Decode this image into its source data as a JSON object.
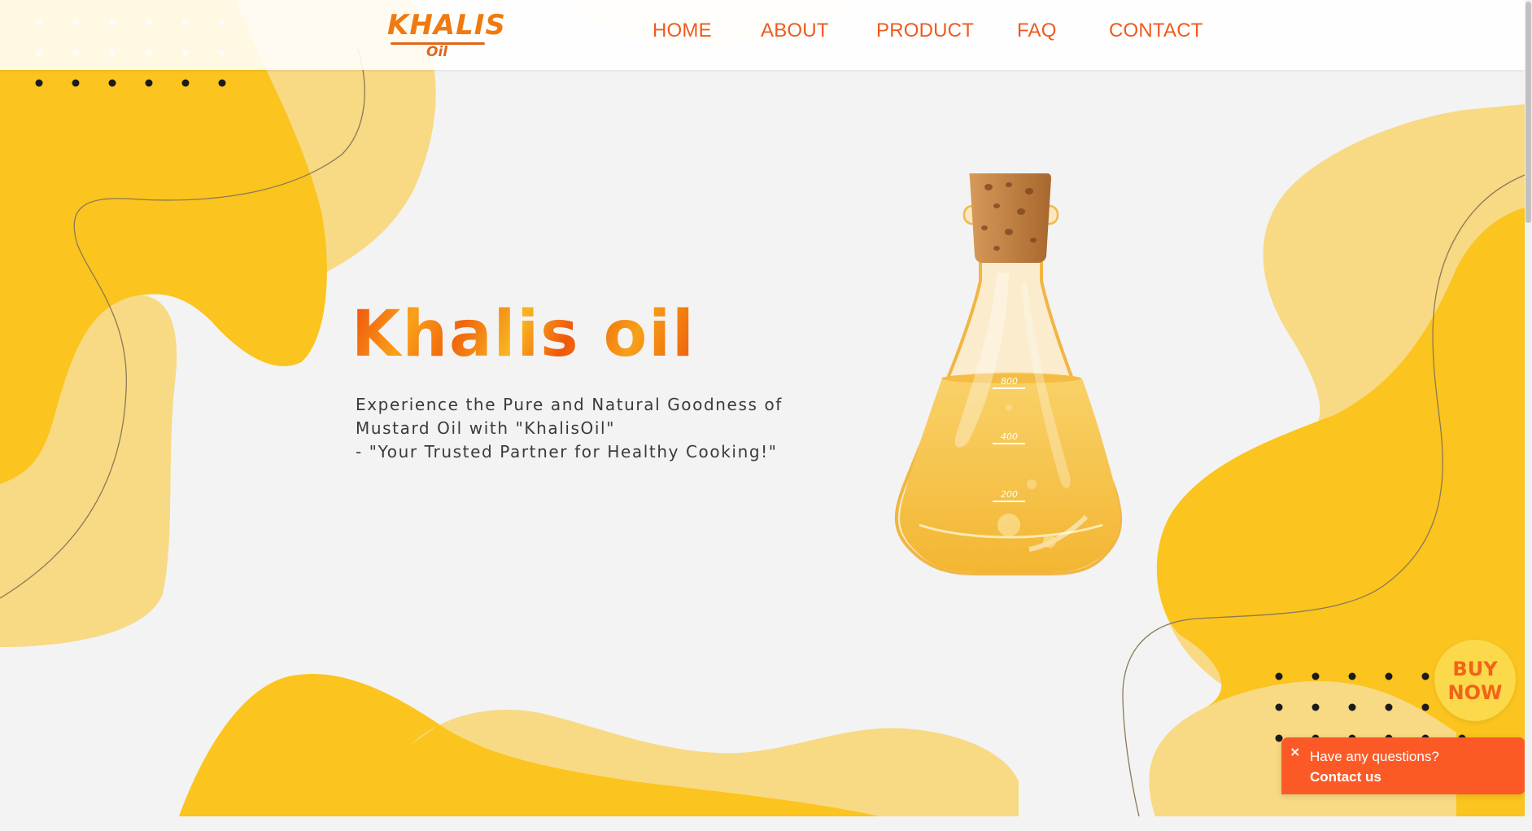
{
  "brand": {
    "logo_text": "KHALIS",
    "logo_subtext": "Oil"
  },
  "nav": {
    "items": [
      {
        "label": "HOME"
      },
      {
        "label": "ABOUT"
      },
      {
        "label": "PRODUCT"
      },
      {
        "label": "FAQ"
      },
      {
        "label": "CONTACT"
      }
    ]
  },
  "hero": {
    "title": "Khalis oil",
    "description_lines": [
      "Experience the Pure and Natural Goodness of",
      "Mustard Oil with \"KhalisOil\"",
      "- \"Your Trusted Partner for Healthy Cooking!\""
    ]
  },
  "flask": {
    "markings": [
      "800",
      "400",
      "200"
    ]
  },
  "buy_now": {
    "line1": "BUY",
    "line2": "NOW"
  },
  "contact_popup": {
    "close_symbol": "×",
    "question": "Have any questions?",
    "cta": "Contact us"
  },
  "colors": {
    "accent": "#ee5a1e",
    "yellow": "#fbc41e",
    "light_yellow": "#f8d984",
    "background": "#f3f3f3",
    "popup": "#fb5a26"
  }
}
